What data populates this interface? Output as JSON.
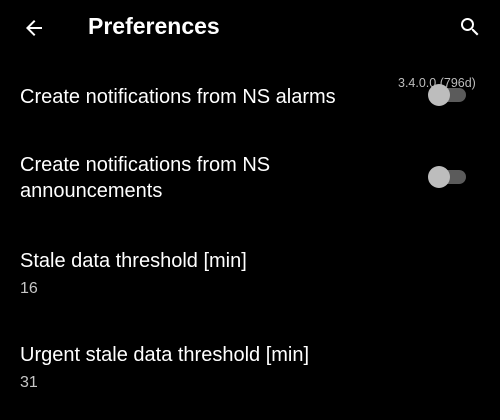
{
  "app_bar": {
    "title": "Preferences",
    "back_icon": "arrow-left-icon",
    "search_icon": "search-icon"
  },
  "version_label": "3.4.0.0 (796d)",
  "preferences": [
    {
      "title": "Create notifications from NS alarms",
      "type": "switch",
      "checked": false
    },
    {
      "title_line1": "Create notifications from NS",
      "title_line2": "announcements",
      "type": "switch",
      "checked": false
    },
    {
      "title": "Stale data threshold [min]",
      "summary": "16"
    },
    {
      "title": "Urgent stale data threshold [min]",
      "summary": "31"
    }
  ],
  "colors": {
    "background": "#000000",
    "text_primary": "#ffffff",
    "text_secondary": "#c7c7c7",
    "switch_thumb_off": "#bdbdbd",
    "switch_track_off": "#5b5b5b"
  }
}
